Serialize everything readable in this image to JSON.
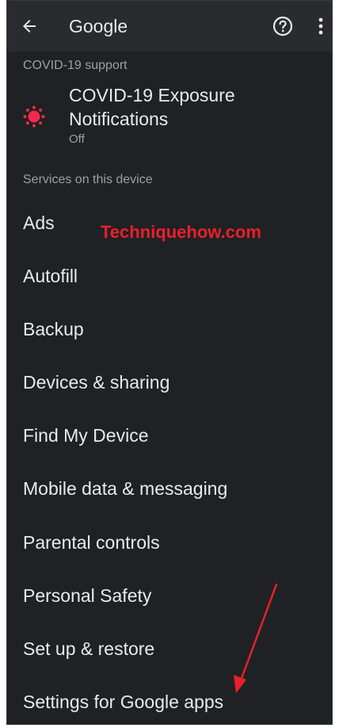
{
  "header": {
    "title": "Google",
    "back_icon": "arrow-left-icon",
    "help_icon": "help-circle-icon",
    "more_icon": "more-vert-icon"
  },
  "covid_section": {
    "header": "COVID-19 support",
    "item": {
      "title": "COVID-19 Exposure Notifications",
      "status": "Off",
      "icon": "exposure-notification-icon",
      "icon_color": "#f2294e"
    }
  },
  "services_section": {
    "header": "Services on this device",
    "items": [
      {
        "label": "Ads"
      },
      {
        "label": "Autofill"
      },
      {
        "label": "Backup"
      },
      {
        "label": "Devices & sharing"
      },
      {
        "label": "Find My Device"
      },
      {
        "label": "Mobile data & messaging"
      },
      {
        "label": "Parental controls"
      },
      {
        "label": "Personal Safety"
      },
      {
        "label": "Set up & restore"
      },
      {
        "label": "Settings for Google apps"
      }
    ]
  },
  "watermark": {
    "text": "Techniquehow.com",
    "color": "#e8202a"
  },
  "annotation": {
    "arrow_color": "#e8202a"
  },
  "colors": {
    "background": "#202124",
    "appbar": "#2a2b2e",
    "text_primary": "#e8eaed",
    "text_secondary": "#9aa0a6"
  }
}
